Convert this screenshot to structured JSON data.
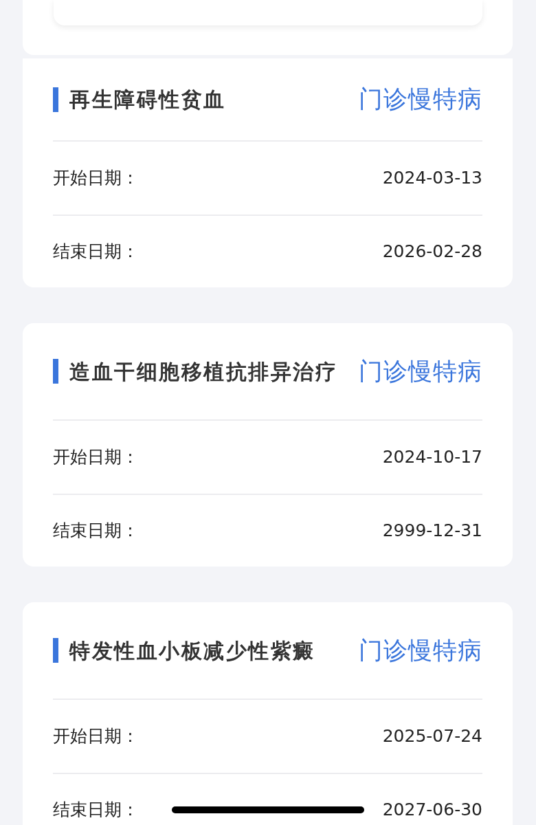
{
  "records": [
    {
      "title": "再生障碍性贫血",
      "tag": "门诊慢特病",
      "rows": [
        {
          "label": "开始日期：",
          "value": "2024-03-13"
        },
        {
          "label": "结束日期：",
          "value": "2026-02-28"
        }
      ]
    },
    {
      "title": "造血干细胞移植抗排异治疗",
      "tag": "门诊慢特病",
      "rows": [
        {
          "label": "开始日期：",
          "value": "2024-10-17"
        },
        {
          "label": "结束日期：",
          "value": "2999-12-31"
        }
      ]
    },
    {
      "title": "特发性血小板减少性紫癜",
      "tag": "门诊慢特病",
      "rows": [
        {
          "label": "开始日期：",
          "value": "2025-07-24"
        },
        {
          "label": "结束日期：",
          "value": "2027-06-30"
        }
      ]
    }
  ]
}
